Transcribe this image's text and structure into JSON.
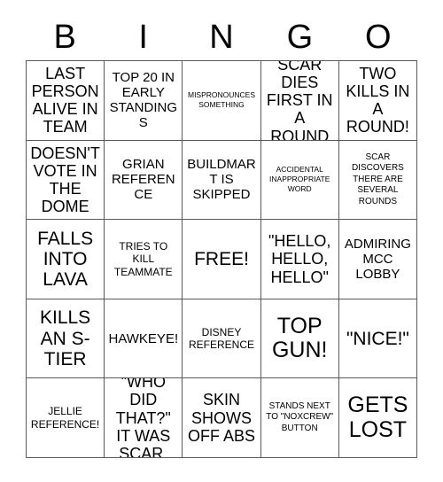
{
  "card": {
    "title": "Bingo Card",
    "header_letters": [
      "B",
      "I",
      "N",
      "G",
      "O"
    ],
    "columns": 5,
    "rows": 5,
    "colors": {
      "background": "#ffffff",
      "text": "#000000",
      "border": "#5a5a5a"
    },
    "cells": [
      [
        {
          "text": "LAST PERSON ALIVE IN TEAM",
          "size": "l",
          "free": false
        },
        {
          "text": "TOP 20 IN EARLY STANDINGS",
          "size": "m",
          "free": false
        },
        {
          "text": "MISPRONOUNCES SOMETHING",
          "size": "xxs",
          "free": false
        },
        {
          "text": "SCAR DIES FIRST IN A ROUND",
          "size": "l",
          "free": false
        },
        {
          "text": "TWO KILLS IN A ROUND!",
          "size": "l",
          "free": false
        }
      ],
      [
        {
          "text": "DOESN'T VOTE IN THE DOME",
          "size": "l",
          "free": false
        },
        {
          "text": "GRIAN REFERENCE",
          "size": "m",
          "free": false
        },
        {
          "text": "BUILDMART IS SKIPPED",
          "size": "m",
          "free": false
        },
        {
          "text": "ACCIDENTAL INAPPROPRIATE WORD",
          "size": "xxs",
          "free": false
        },
        {
          "text": "SCAR DISCOVERS THERE ARE SEVERAL ROUNDS",
          "size": "xs",
          "free": false
        }
      ],
      [
        {
          "text": "FALLS INTO LAVA",
          "size": "xl",
          "free": false
        },
        {
          "text": "TRIES TO KILL TEAMMATE",
          "size": "s",
          "free": false
        },
        {
          "text": "FREE!",
          "size": "xl",
          "free": true
        },
        {
          "text": "\"HELLO, HELLO, HELLO\"",
          "size": "l",
          "free": false
        },
        {
          "text": "ADMIRING MCC LOBBY",
          "size": "m",
          "free": false
        }
      ],
      [
        {
          "text": "KILLS AN S-TIER",
          "size": "xl",
          "free": false
        },
        {
          "text": "HAWKEYE!",
          "size": "m",
          "free": false
        },
        {
          "text": "DISNEY REFERENCE",
          "size": "s",
          "free": false
        },
        {
          "text": "TOP GUN!",
          "size": "xxl",
          "free": false
        },
        {
          "text": "\"NICE!\"",
          "size": "xl",
          "free": false
        }
      ],
      [
        {
          "text": "JELLIE REFERENCE!",
          "size": "s",
          "free": false
        },
        {
          "text": "\"WHO DID THAT?\" IT WAS SCAR.",
          "size": "l",
          "free": false
        },
        {
          "text": "SKIN SHOWS OFF ABS",
          "size": "l",
          "free": false
        },
        {
          "text": "STANDS NEXT TO \"NOXCREW\" BUTTON",
          "size": "xs",
          "free": false
        },
        {
          "text": "GETS LOST",
          "size": "xxl",
          "free": false
        }
      ]
    ]
  }
}
